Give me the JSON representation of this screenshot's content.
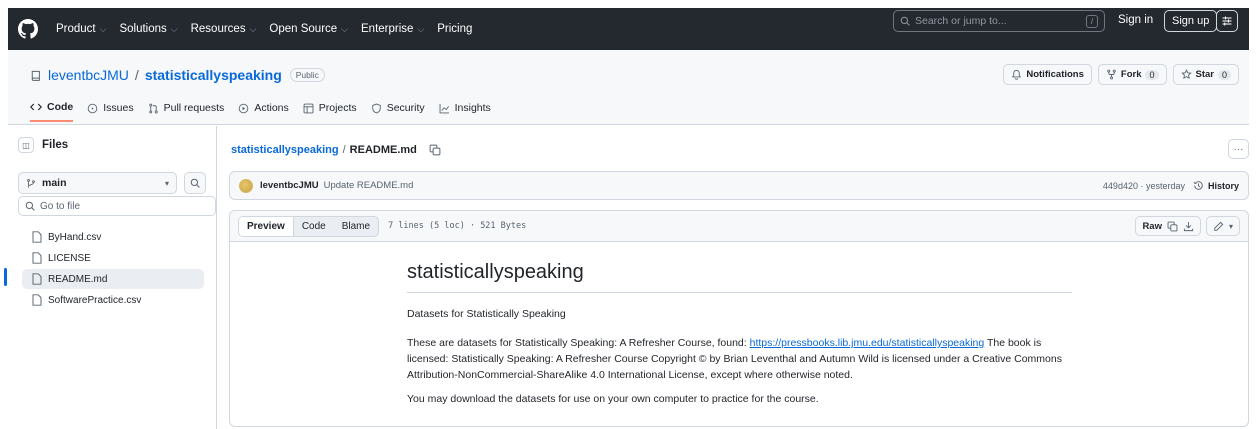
{
  "header": {
    "nav": [
      {
        "label": "Product",
        "chevron": true
      },
      {
        "label": "Solutions",
        "chevron": true
      },
      {
        "label": "Resources",
        "chevron": true
      },
      {
        "label": "Open Source",
        "chevron": true
      },
      {
        "label": "Enterprise",
        "chevron": true
      },
      {
        "label": "Pricing",
        "chevron": false
      }
    ],
    "search_placeholder": "Search or jump to...",
    "search_shortcut": "/",
    "sign_in": "Sign in",
    "sign_up": "Sign up"
  },
  "repo": {
    "owner": "leventbcJMU",
    "separator": "/",
    "name": "statisticallyspeaking",
    "visibility": "Public",
    "notifications_label": "Notifications",
    "fork_label": "Fork",
    "fork_count": "0",
    "star_label": "Star",
    "star_count": "0",
    "tabs": [
      "Code",
      "Issues",
      "Pull requests",
      "Actions",
      "Projects",
      "Security",
      "Insights"
    ]
  },
  "sidebar": {
    "title": "Files",
    "branch": "main",
    "goto_placeholder": "Go to file",
    "files": [
      "ByHand.csv",
      "LICENSE",
      "README.md",
      "SoftwarePractice.csv"
    ],
    "active_file": "README.md"
  },
  "main": {
    "breadcrumb_root": "statisticallyspeaking",
    "breadcrumb_sep": "/",
    "breadcrumb_file": "README.md",
    "commit": {
      "author": "leventbcJMU",
      "message": "Update README.md",
      "hash_time": "449d420 · yesterday",
      "history_label": "History"
    },
    "file_head": {
      "preview": "Preview",
      "code": "Code",
      "blame": "Blame",
      "meta": "7 lines (5 loc) · 521 Bytes",
      "raw": "Raw"
    },
    "readme": {
      "title": "statisticallyspeaking",
      "subtitle": "Datasets for Statistically Speaking",
      "p1_before": "These are datasets for Statistically Speaking: A Refresher Course, found: ",
      "p1_link": "https://pressbooks.lib.jmu.edu/statisticallyspeaking",
      "p1_after": " The book is licensed: Statistically Speaking: A Refresher Course Copyright © by Brian Leventhal and Autumn Wild is licensed under a Creative Commons Attribution-NonCommercial-ShareAlike 4.0 International License, except where otherwise noted.",
      "p2": "You may download the datasets for use on your own computer to practice for the course."
    }
  },
  "colors": {
    "header_bg": "#24292f",
    "link": "#0969da",
    "active_tab_underline": "#fd8c73"
  }
}
